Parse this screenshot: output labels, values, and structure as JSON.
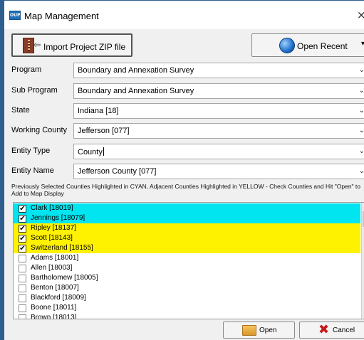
{
  "window": {
    "title": "Map Management",
    "app_icon_text": "OUPS",
    "close_glyph": "×"
  },
  "toolbar": {
    "import_label": "Import Project ZIP file",
    "import_arrow": "⇦",
    "open_recent_label": "Open Recent",
    "open_recent_caret": "▾"
  },
  "fields": [
    {
      "label": "Program",
      "value": "Boundary and Annexation Survey"
    },
    {
      "label": "Sub Program",
      "value": "Boundary and Annexation Survey"
    },
    {
      "label": "State",
      "value": "Indiana [18]"
    },
    {
      "label": "Working County",
      "value": "Jefferson [077]"
    },
    {
      "label": "Entity Type",
      "value": "County"
    },
    {
      "label": "Entity Name",
      "value": "Jefferson County [077]"
    }
  ],
  "dropdown_glyph": "⌄",
  "notice": "Previously Selected Counties Highlighted in CYAN, Adjacent Counties Highlighted in YELLOW - Check Counties and Hit \"Open\" to Add to Map Display",
  "counties": [
    {
      "name": "Clark [18019]",
      "checked": true,
      "highlight": "cyan"
    },
    {
      "name": "Jennings [18079]",
      "checked": true,
      "highlight": "cyan"
    },
    {
      "name": "Ripley [18137]",
      "checked": true,
      "highlight": "yellow"
    },
    {
      "name": "Scott [18143]",
      "checked": true,
      "highlight": "yellow"
    },
    {
      "name": "Switzerland [18155]",
      "checked": true,
      "highlight": "yellow"
    },
    {
      "name": "Adams [18001]",
      "checked": false,
      "highlight": "none"
    },
    {
      "name": "Allen [18003]",
      "checked": false,
      "highlight": "none"
    },
    {
      "name": "Bartholomew [18005]",
      "checked": false,
      "highlight": "none"
    },
    {
      "name": "Benton [18007]",
      "checked": false,
      "highlight": "none"
    },
    {
      "name": "Blackford [18009]",
      "checked": false,
      "highlight": "none"
    },
    {
      "name": "Boone [18011]",
      "checked": false,
      "highlight": "none"
    },
    {
      "name": "Brown [18013]",
      "checked": false,
      "highlight": "none"
    }
  ],
  "colors": {
    "cyan": "#00e5f0",
    "yellow": "#fff200",
    "title_border": "#2e5f8f"
  },
  "buttons": {
    "open_label": "Open",
    "cancel_label": "Cancel",
    "cancel_glyph": "✖"
  },
  "icons": {
    "import": "zip-file-icon",
    "open_recent": "globe-icon",
    "open": "folder-icon",
    "cancel": "red-x-icon"
  }
}
